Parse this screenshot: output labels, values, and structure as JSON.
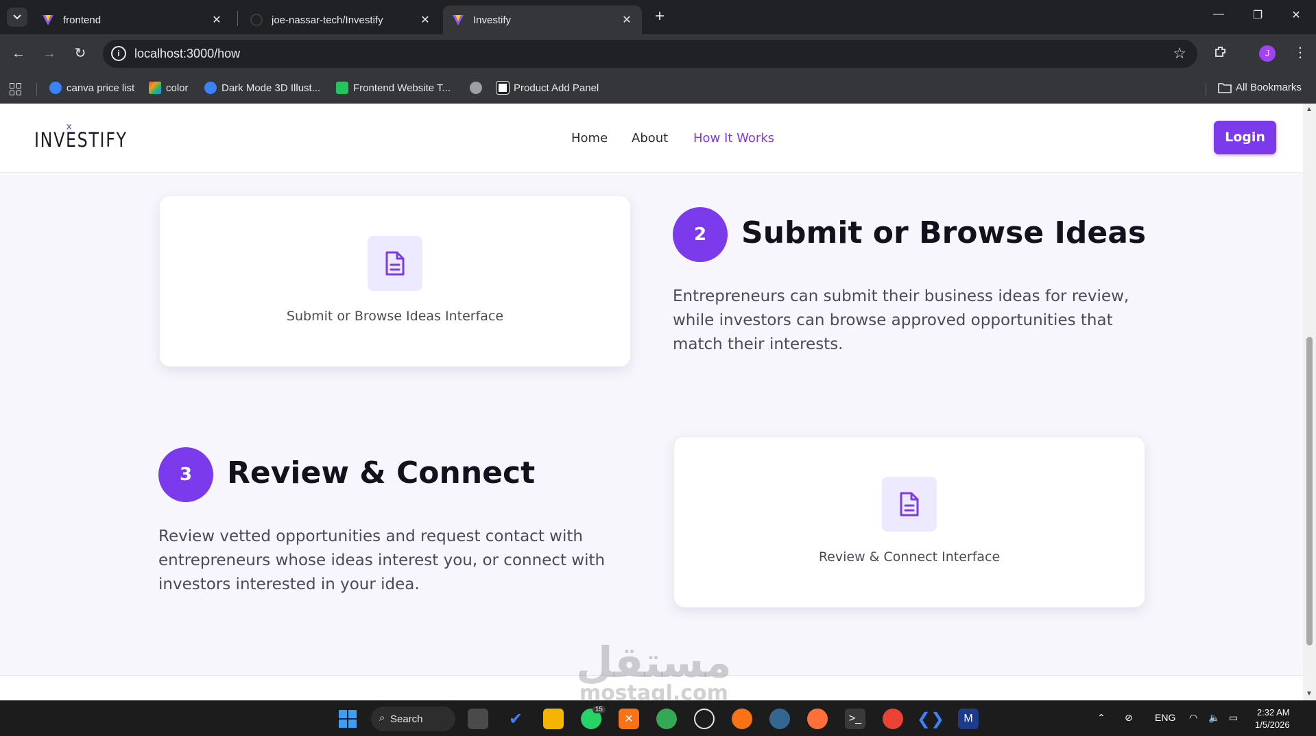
{
  "browser": {
    "tabs": [
      {
        "title": "frontend",
        "favicon": "vite-icon",
        "active": false
      },
      {
        "title": "joe-nassar-tech/Investify",
        "favicon": "github-icon",
        "active": false
      },
      {
        "title": "Investify",
        "favicon": "vite-icon",
        "active": true
      }
    ],
    "url": "localhost:3000/how",
    "profile_initial": "J",
    "bookmarks": [
      {
        "label": "canva price list",
        "icon": "canva-icon"
      },
      {
        "label": "color",
        "icon": "color-icon"
      },
      {
        "label": "Dark Mode 3D Illust...",
        "icon": "canva-icon"
      },
      {
        "label": "Frontend Website T...",
        "icon": "frontend-icon"
      },
      {
        "label": "",
        "icon": "globe-icon"
      },
      {
        "label": "Product Add Panel",
        "icon": "codepen-icon"
      }
    ],
    "all_bookmarks": "All Bookmarks"
  },
  "site": {
    "logo": "INVESTIFY",
    "nav": [
      "Home",
      "About",
      "How It Works"
    ],
    "active_nav": "How It Works",
    "login": "Login",
    "accent_color": "#7c3aed"
  },
  "steps": [
    {
      "number": "2",
      "title": "Submit or Browse Ideas",
      "description": "Entrepreneurs can submit their business ideas for review, while investors can browse approved opportunities that match their interests.",
      "card_label": "Submit or Browse Ideas Interface",
      "icon": "document-icon"
    },
    {
      "number": "3",
      "title": "Review & Connect",
      "description": "Review vetted opportunities and request contact with entrepreneurs whose ideas interest you, or connect with investors interested in your idea.",
      "card_label": "Review & Connect Interface",
      "icon": "document-icon"
    }
  ],
  "watermark": {
    "arabic": "مستقل",
    "latin": "mostaql.com"
  },
  "taskbar": {
    "search": "Search",
    "whatsapp_badge": "15",
    "language": "ENG",
    "time": "2:32 AM",
    "date": "1/5/2026"
  }
}
